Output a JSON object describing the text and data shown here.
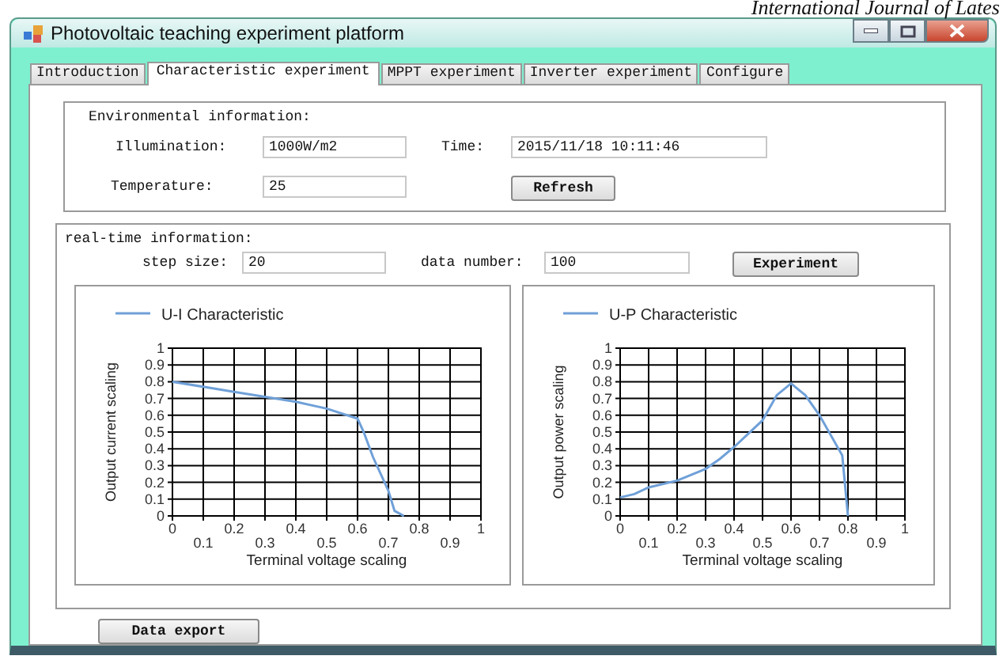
{
  "page_header": "International Journal of Lates",
  "window": {
    "title": "Photovoltaic teaching experiment platform"
  },
  "tabs": [
    {
      "label": "Introduction",
      "selected": false
    },
    {
      "label": "Characteristic experiment",
      "selected": true
    },
    {
      "label": "MPPT experiment",
      "selected": false
    },
    {
      "label": "Inverter experiment",
      "selected": false
    },
    {
      "label": "Configure",
      "selected": false
    }
  ],
  "environmental_information": {
    "title": "Environmental information:",
    "fields": [
      {
        "label": "Illumination:",
        "value": "1000W/m2"
      },
      {
        "label": "Time:",
        "value": "2015/11/18 10:11:46"
      },
      {
        "label": "Temperature:",
        "value": "25"
      }
    ],
    "button": "Refresh"
  },
  "realtime_information": {
    "title": "real-time information:",
    "fields": [
      {
        "label": "step size:",
        "value": "20"
      },
      {
        "label": "data number:",
        "value": "100"
      }
    ],
    "button": "Experiment",
    "charts": [
      {
        "chart_data": {
          "type": "line",
          "grid": true,
          "xlabel": "Terminal voltage scaling",
          "ylabel": "Output current scaling",
          "xlim": [
            0,
            1
          ],
          "ylim": [
            0,
            1
          ],
          "xticks": [
            0,
            0.2,
            0.4,
            0.6,
            0.8,
            1
          ],
          "annotations": [
            "0.1",
            "0.3",
            "0.5",
            "0.7",
            "0.9"
          ],
          "yticks": [
            0,
            0.1,
            0.2,
            0.3,
            0.4,
            0.5,
            0.6,
            0.7,
            0.8,
            0.9,
            1
          ],
          "x": [
            0,
            0.1,
            0.2,
            0.3,
            0.4,
            0.5,
            0.6,
            0.62,
            0.65,
            0.7,
            0.72,
            0.75
          ],
          "series": [
            {
              "name": "U-I Characteristic",
              "color": "#6fa0d8",
              "values": [
                0.8,
                0.77,
                0.74,
                0.71,
                0.68,
                0.64,
                0.58,
                0.5,
                0.35,
                0.15,
                0.03,
                0
              ]
            }
          ]
        }
      },
      {
        "chart_data": {
          "type": "line",
          "grid": true,
          "xlabel": "Terminal voltage scaling",
          "ylabel": "Output power scaling",
          "xlim": [
            0,
            1
          ],
          "ylim": [
            0,
            1
          ],
          "xticks": [
            0,
            0.2,
            0.4,
            0.6,
            0.8,
            1
          ],
          "annotations": [
            "0.1",
            "0.3",
            "0.5",
            "0.7",
            "0.9"
          ],
          "yticks": [
            0,
            0.1,
            0.2,
            0.3,
            0.4,
            0.5,
            0.6,
            0.7,
            0.8,
            0.9,
            1
          ],
          "x": [
            0,
            0.05,
            0.1,
            0.2,
            0.3,
            0.35,
            0.4,
            0.5,
            0.55,
            0.6,
            0.65,
            0.7,
            0.78,
            0.8
          ],
          "series": [
            {
              "name": "U-P Characteristic",
              "color": "#6fa0d8",
              "values": [
                0.11,
                0.13,
                0.17,
                0.21,
                0.28,
                0.34,
                0.41,
                0.57,
                0.72,
                0.79,
                0.72,
                0.6,
                0.36,
                0
              ]
            }
          ]
        }
      }
    ]
  },
  "buttons": [
    "Data export"
  ]
}
